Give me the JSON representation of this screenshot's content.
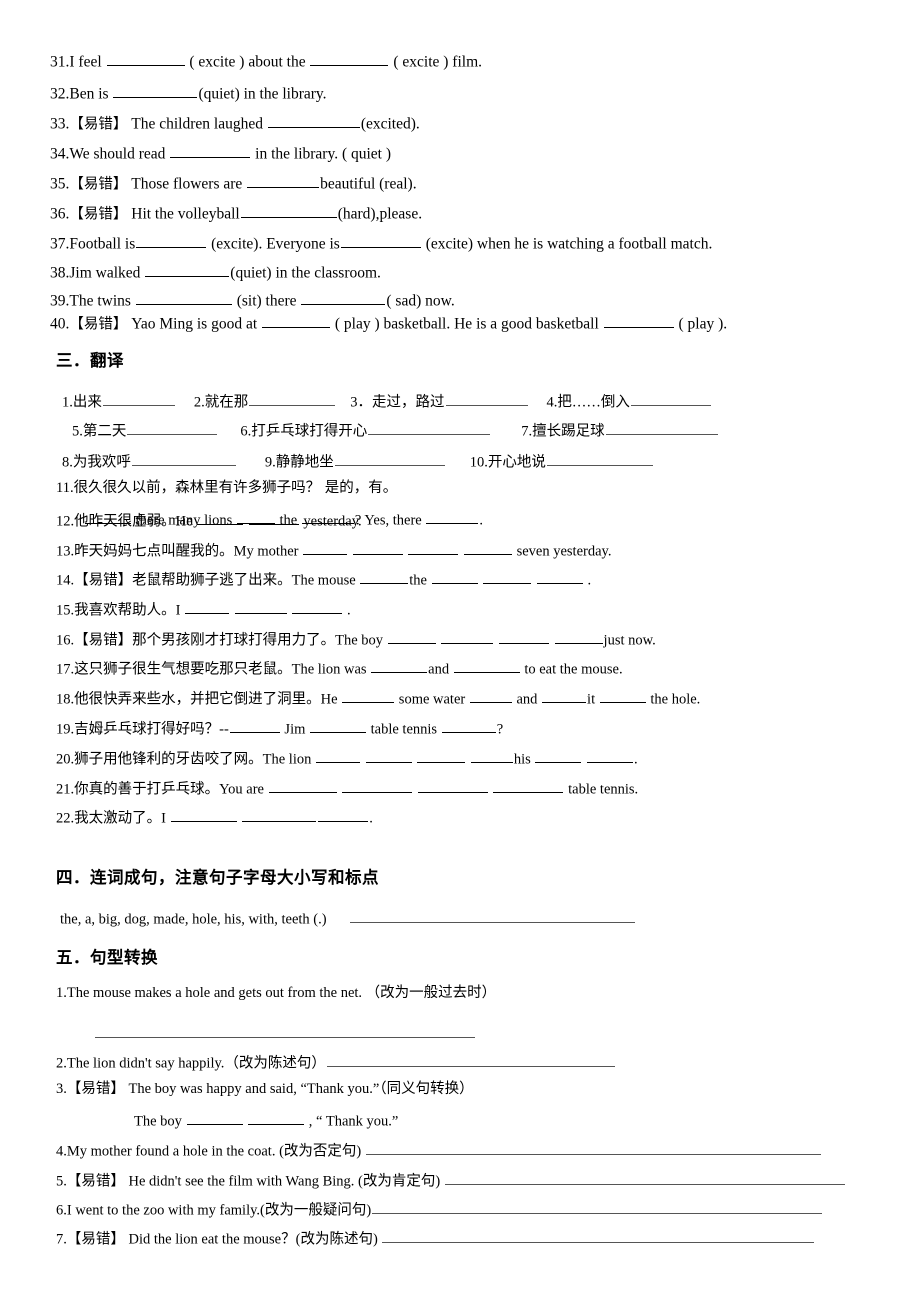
{
  "document": {
    "type": "chinese-english-grammar-worksheet",
    "background": "#ffffff",
    "text_color": "#000000"
  },
  "fill_in_blanks": {
    "items": [
      {
        "num": "31.",
        "marker": "",
        "parts": [
          "I feel ",
          "BLANK",
          " ( excite ) about the ",
          "BLANK",
          " ( excite ) film."
        ]
      },
      {
        "num": "32.",
        "marker": "",
        "parts": [
          "Ben is   ",
          "BLANK",
          "(quiet) in the library."
        ]
      },
      {
        "num": "33.",
        "marker": "【易错】",
        "parts": [
          " The children laughed  ",
          "BLANK",
          "(excited)."
        ]
      },
      {
        "num": "34.",
        "marker": "",
        "parts": [
          "We should read ",
          "BLANK",
          " in the library. ( quiet )"
        ]
      },
      {
        "num": "35.",
        "marker": "【易错】",
        "parts": [
          " Those flowers are ",
          "BLANK",
          "beautiful (real)."
        ]
      },
      {
        "num": "36.",
        "marker": "【易错】",
        "parts": [
          " Hit the volleyball",
          "BLANK",
          "(hard),please."
        ]
      },
      {
        "num": "37.",
        "marker": "",
        "parts": [
          "Football is",
          "BLANK",
          " (excite). Everyone is",
          "BLANK",
          " (excite) when he is watching a football match."
        ]
      },
      {
        "num": "38.",
        "marker": "",
        "parts": [
          "Jim walked ",
          "BLANK",
          "(quiet) in the classroom."
        ]
      },
      {
        "num": "39.",
        "marker": "",
        "parts": [
          "The twins  ",
          "BLANK",
          " (sit)   there ",
          "BLANK",
          "( sad) now."
        ]
      },
      {
        "num": "40.",
        "marker": "【易错】",
        "parts": [
          " Yao Ming is good at ",
          "BLANK",
          " ( play ) basketball. He is a good basketball ",
          "BLANK",
          " ( play )."
        ]
      }
    ]
  },
  "section_three": {
    "heading": "三．翻译",
    "phrase_rows": [
      {
        "items": [
          {
            "label": "1.出来",
            "blank_w": 72
          },
          {
            "label": "2.就在那",
            "blank_w": 86,
            "gap": 18
          },
          {
            "label": "3．走过，路过",
            "blank_w": 82,
            "gap": 14
          },
          {
            "label": "4.把……倒入",
            "blank_w": 80,
            "gap": 18
          }
        ]
      },
      {
        "items": [
          {
            "label": "5.第二天",
            "blank_w": 90,
            "gap": 10
          },
          {
            "label": "6.打乒乓球打得开心",
            "blank_w": 122,
            "gap": 22
          },
          {
            "label": "7.擅长踢足球",
            "blank_w": 112,
            "gap": 30
          }
        ]
      },
      {
        "items": [
          {
            "label": "8.为我欢呼",
            "blank_w": 104
          },
          {
            "label": "9.静静地坐",
            "blank_w": 110,
            "gap": 28
          },
          {
            "label": "10.开心地说",
            "blank_w": 106,
            "gap": 24
          }
        ]
      }
    ],
    "sentences": [
      {
        "num": "11.",
        "marker": "",
        "cn": "很久很久以前，森林里有许多狮子吗？  是的，有。",
        "en_indent": 28,
        "en_parts": [
          " ",
          "BLANK",
          " there many lions ",
          "BLANK",
          " the ",
          "BLANK",
          "?   Yes, there ",
          "BLANK",
          "."
        ]
      },
      {
        "num": "12.",
        "marker": "",
        "cn": "他昨天很虚弱。",
        "en_parts": [
          "He   ",
          "BLANK",
          "  ",
          "BLANK",
          " yesterday."
        ]
      },
      {
        "num": "13.",
        "marker": "",
        "cn": "昨天妈妈七点叫醒我的。",
        "en_parts": [
          "My mother   ",
          "BLANK",
          "  ",
          "BLANK",
          "  ",
          "BLANK",
          "  ",
          "BLANK",
          " seven yesterday."
        ]
      },
      {
        "num": "14.",
        "marker": "【易错】",
        "cn": "老鼠帮助狮子逃了出来。",
        "en_parts": [
          "The mouse   ",
          "BLANK",
          "the  ",
          "BLANK",
          "  ",
          "BLANK",
          "  ",
          "BLANK",
          " ."
        ]
      },
      {
        "num": "15.",
        "marker": "",
        "cn": "我喜欢帮助人。",
        "en_parts": [
          "I  ",
          "BLANK",
          "  ",
          "BLANK",
          "  ",
          "BLANK",
          " ."
        ]
      },
      {
        "num": "16.",
        "marker": "【易错】",
        "cn": "那个男孩刚才打球打得用力了。",
        "en_parts": [
          "The boy  ",
          "BLANK",
          "  ",
          "BLANK",
          "  ",
          "BLANK",
          "  ",
          "BLANK",
          "just now."
        ]
      },
      {
        "num": "17.",
        "marker": "",
        "cn": "这只狮子很生气想要吃那只老鼠。",
        "en_parts": [
          "The lion was ",
          "BLANK",
          "and ",
          "BLANK",
          " to eat the mouse."
        ]
      },
      {
        "num": "18.",
        "marker": "",
        "cn": "他很快弄来些水，并把它倒进了洞里。",
        "en_parts": [
          "He ",
          "BLANK",
          " some water ",
          "BLANK",
          " and ",
          "BLANK",
          "it ",
          "BLANK",
          " the hole."
        ]
      },
      {
        "num": "19.",
        "marker": "",
        "cn": "吉姆乒乓球打得好吗？",
        "en_parts": [
          "--",
          "BLANK",
          "  Jim ",
          "BLANK",
          " table tennis ",
          "BLANK",
          "?"
        ]
      },
      {
        "num": "20.",
        "marker": "",
        "cn": "狮子用他锋利的牙齿咬了网。",
        "en_parts": [
          "The lion ",
          "BLANK",
          "  ",
          "BLANK",
          "  ",
          "BLANK",
          "  ",
          "BLANK",
          "his  ",
          "BLANK",
          "  ",
          "BLANK",
          "."
        ]
      },
      {
        "num": "21.",
        "marker": "",
        "cn": "你真的善于打乒乓球。",
        "en_parts": [
          "You are ",
          "BLANK",
          "  ",
          "BLANK",
          "  ",
          "BLANK",
          "  ",
          "BLANK",
          " table tennis."
        ]
      },
      {
        "num": "22.",
        "marker": "",
        "cn": "我太激动了。",
        "en_parts": [
          "I ",
          "BLANK",
          "  ",
          "BLANK",
          "",
          "BLANK",
          "."
        ]
      }
    ]
  },
  "section_four": {
    "heading": "四．连词成句，注意句子字母大小写和标点",
    "item": {
      "words": "the, a, big, dog, made, hole, his, with, teeth (.)",
      "answer_blank_w": 285
    }
  },
  "section_five": {
    "heading": "五．句型转换",
    "items": [
      {
        "num": "1.",
        "marker": "",
        "text": "The mouse makes a hole and gets out from the net. （改为一般过去时）",
        "blank_below": true,
        "below_w": 380,
        "below_indent": 38
      },
      {
        "num": "2.",
        "marker": "",
        "text": "The lion didn't say happily.（改为陈述句）",
        "inline_blank_w": 288
      },
      {
        "num": "3.",
        "marker": "【易错】",
        "text": " The boy was happy and said, “Thank you.”（同义句转换）",
        "sub_indent": 78,
        "sub_parts": [
          "The boy ",
          "BLANK",
          " ",
          "BLANK",
          " , “ Thank you.”"
        ]
      },
      {
        "num": "4.",
        "marker": "",
        "text": "My mother found a hole in the coat. (改为否定句) ",
        "inline_blank_w": 455
      },
      {
        "num": "5.",
        "marker": "【易错】",
        "text": " He didn't see the film with Wang Bing. (改为肯定句) ",
        "inline_blank_w": 400
      },
      {
        "num": "6.",
        "marker": "",
        "text": "I went to the zoo with my family.(改为一般疑问句)",
        "inline_blank_w": 450
      },
      {
        "num": "7.",
        "marker": "【易错】",
        "text": " Did the lion eat the mouse？(改为陈述句) ",
        "inline_blank_w": 432
      }
    ]
  }
}
